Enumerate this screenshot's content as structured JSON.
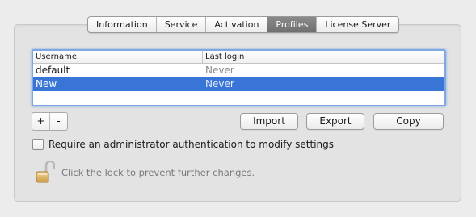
{
  "tabs": [
    {
      "label": "Information",
      "active": false
    },
    {
      "label": "Service",
      "active": false
    },
    {
      "label": "Activation",
      "active": false
    },
    {
      "label": "Profiles",
      "active": true
    },
    {
      "label": "License Server",
      "active": false
    }
  ],
  "table": {
    "headers": {
      "username": "Username",
      "last_login": "Last login"
    },
    "rows": [
      {
        "username": "default",
        "last_login": "Never",
        "selected": false
      },
      {
        "username": "New",
        "last_login": "Never",
        "selected": true
      }
    ]
  },
  "controls": {
    "add_label": "+",
    "remove_label": "-",
    "import_label": "Import",
    "export_label": "Export",
    "copy_label": "Copy"
  },
  "checkbox": {
    "label": "Require an administrator authentication to modify settings",
    "checked": false
  },
  "lock": {
    "icon": "lock-open-icon",
    "text": "Click the lock to prevent further changes."
  },
  "colors": {
    "selection": "#3875d7",
    "active_tab": "#7a7a7a"
  }
}
